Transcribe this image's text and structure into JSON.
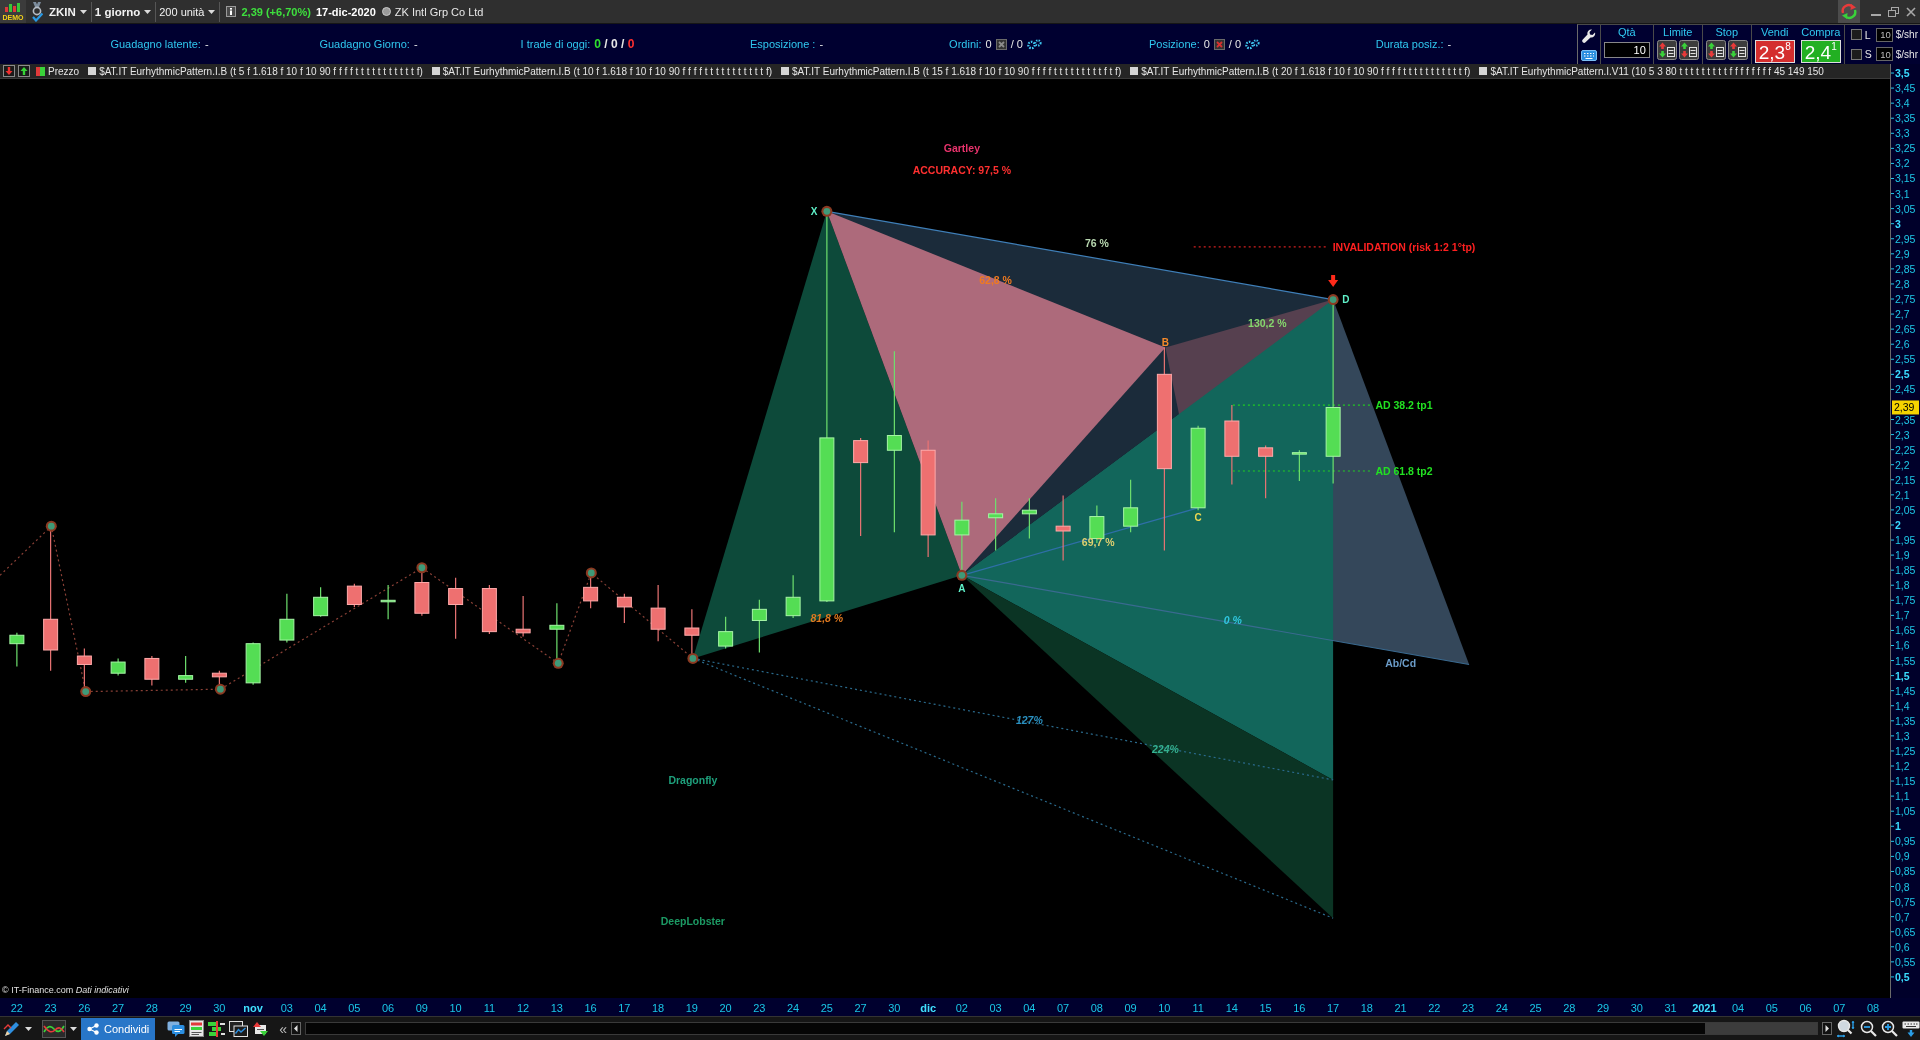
{
  "title_bar": {
    "badge": "DEMO",
    "symbol": "ZKIN",
    "timeframe": "1 giorno",
    "quantity": "200 unità",
    "price_change": "2,39 (+6,70%)",
    "date": "17-dic-2020",
    "company": "ZK Intl Grp Co Ltd"
  },
  "info_bar": [
    {
      "kind": "text",
      "label": "Guadagno latente:",
      "value": "-"
    },
    {
      "kind": "text",
      "label": "Guadagno Giorno:",
      "value": "-"
    },
    {
      "kind": "split",
      "label": "I trade di oggi:",
      "segments": [
        {
          "text": "0",
          "color": "#2ee02e"
        },
        {
          "text": "/ 0 /",
          "color": "#e6e6e6"
        },
        {
          "text": "0",
          "color": "#ff3030"
        }
      ]
    },
    {
      "kind": "text",
      "label": "Esposizione :",
      "value": "-"
    },
    {
      "kind": "counts",
      "label": "Ordini:",
      "values": [
        "0",
        "/ 0"
      ],
      "color": "#8c8c8c"
    },
    {
      "kind": "counts",
      "label": "Posizione:",
      "values": [
        "0",
        "/ 0"
      ],
      "color": "#d83030"
    },
    {
      "kind": "text",
      "label": "Durata posiz.:",
      "value": "-"
    }
  ],
  "order_panel": {
    "quantity": {
      "label": "Qtà",
      "value": "10"
    },
    "limit_label": "Limite",
    "stop_label": "Stop",
    "sell": {
      "label": "Vendi",
      "price": "2,3$^{8}$"
    },
    "buy": {
      "label": "Compra",
      "price": "2,4$^{1}$"
    },
    "options": [
      {
        "label": "L",
        "checked": false,
        "value": "10",
        "unit": "$/shr"
      },
      {
        "label": "S",
        "checked": false,
        "value": "10",
        "unit": "$/shr"
      }
    ]
  },
  "legend": {
    "series_label": "Prezzo",
    "indicators": [
      {
        "label": "$AT.IT EurhythmicPattern.I.B (t 5 f 1.618 f 10 f 10 90 f f f f t t t t t t t t t t t f)",
        "checked": false
      },
      {
        "label": "$AT.IT EurhythmicPattern.I.B (t 10 f 1.618 f 10 f 10 90 f f f f t t t t t t t t t t t f)",
        "checked": false
      },
      {
        "label": "$AT.IT EurhythmicPattern.I.B (t 15 f 1.618 f 10 f 10 90 f f f f t t t t t t t t t f t f)",
        "checked": false
      },
      {
        "label": "$AT.IT EurhythmicPattern.I.B (t 20 f 1.618 f 10 f 10 90 f f f f t t t t t t t t t t t f)",
        "checked": false
      },
      {
        "label": "$AT.IT EurhythmicPattern.I.V11 (10 5 3 80 t t t t t t t t t f f f f f f f f 45 149 150",
        "checked": false
      }
    ]
  },
  "chart": {
    "annotations": [
      "X",
      "A",
      "B",
      "C",
      "D",
      "Gartley",
      "ACCURACY: 97,5 %",
      "76 %",
      "62,8 %",
      "130,2 %",
      "69,7 %",
      "81,8 %",
      "0 %",
      "127%",
      "224%",
      "INVALIDATION (risk 1:2 1°tp)",
      "AD 38.2 tp1",
      "AD 61.8 tp2",
      "Ab/Cd",
      "Dragonfly",
      "DeepLobster"
    ],
    "price_axis": [
      "3,5",
      "3,45",
      "3,4",
      "3,35",
      "3,3",
      "3,25",
      "3,2",
      "3,15",
      "3,1",
      "3,05",
      "3",
      "2,95",
      "2,9",
      "2,85",
      "2,8",
      "2,75",
      "2,7",
      "2,65",
      "2,6",
      "2,55",
      "2,5",
      "2,45",
      "2,35",
      "2,3",
      "2,25",
      "2,2",
      "2,15",
      "2,1",
      "2,05",
      "2",
      "1,95",
      "1,9",
      "1,85",
      "1,8",
      "1,75",
      "1,7",
      "1,65",
      "1,6",
      "1,55",
      "1,5",
      "1,45",
      "1,4",
      "1,35",
      "1,3",
      "1,25",
      "1,2",
      "1,15",
      "1,1",
      "1,05",
      "1",
      "0,95",
      "0,9",
      "0,85",
      "0,8",
      "0,75",
      "0,7",
      "0,65",
      "0,6",
      "0,55",
      "0,5"
    ],
    "current_price": "2,39",
    "date_axis": [
      "22",
      "23",
      "26",
      "27",
      "28",
      "29",
      "30",
      "nov",
      "03",
      "04",
      "05",
      "06",
      "09",
      "10",
      "11",
      "12",
      "13",
      "16",
      "17",
      "18",
      "19",
      "20",
      "23",
      "24",
      "25",
      "27",
      "30",
      "dic",
      "02",
      "03",
      "04",
      "07",
      "08",
      "09",
      "10",
      "11",
      "14",
      "15",
      "16",
      "17",
      "18",
      "21",
      "22",
      "23",
      "24",
      "25",
      "28",
      "29",
      "30",
      "31",
      "2021",
      "04",
      "05",
      "06",
      "07",
      "08"
    ],
    "copyright": "© IT-Finance.com *Dati indicativi*"
  },
  "toolbar": {
    "share_button": "Condividi",
    "collapse": "«"
  }
}
